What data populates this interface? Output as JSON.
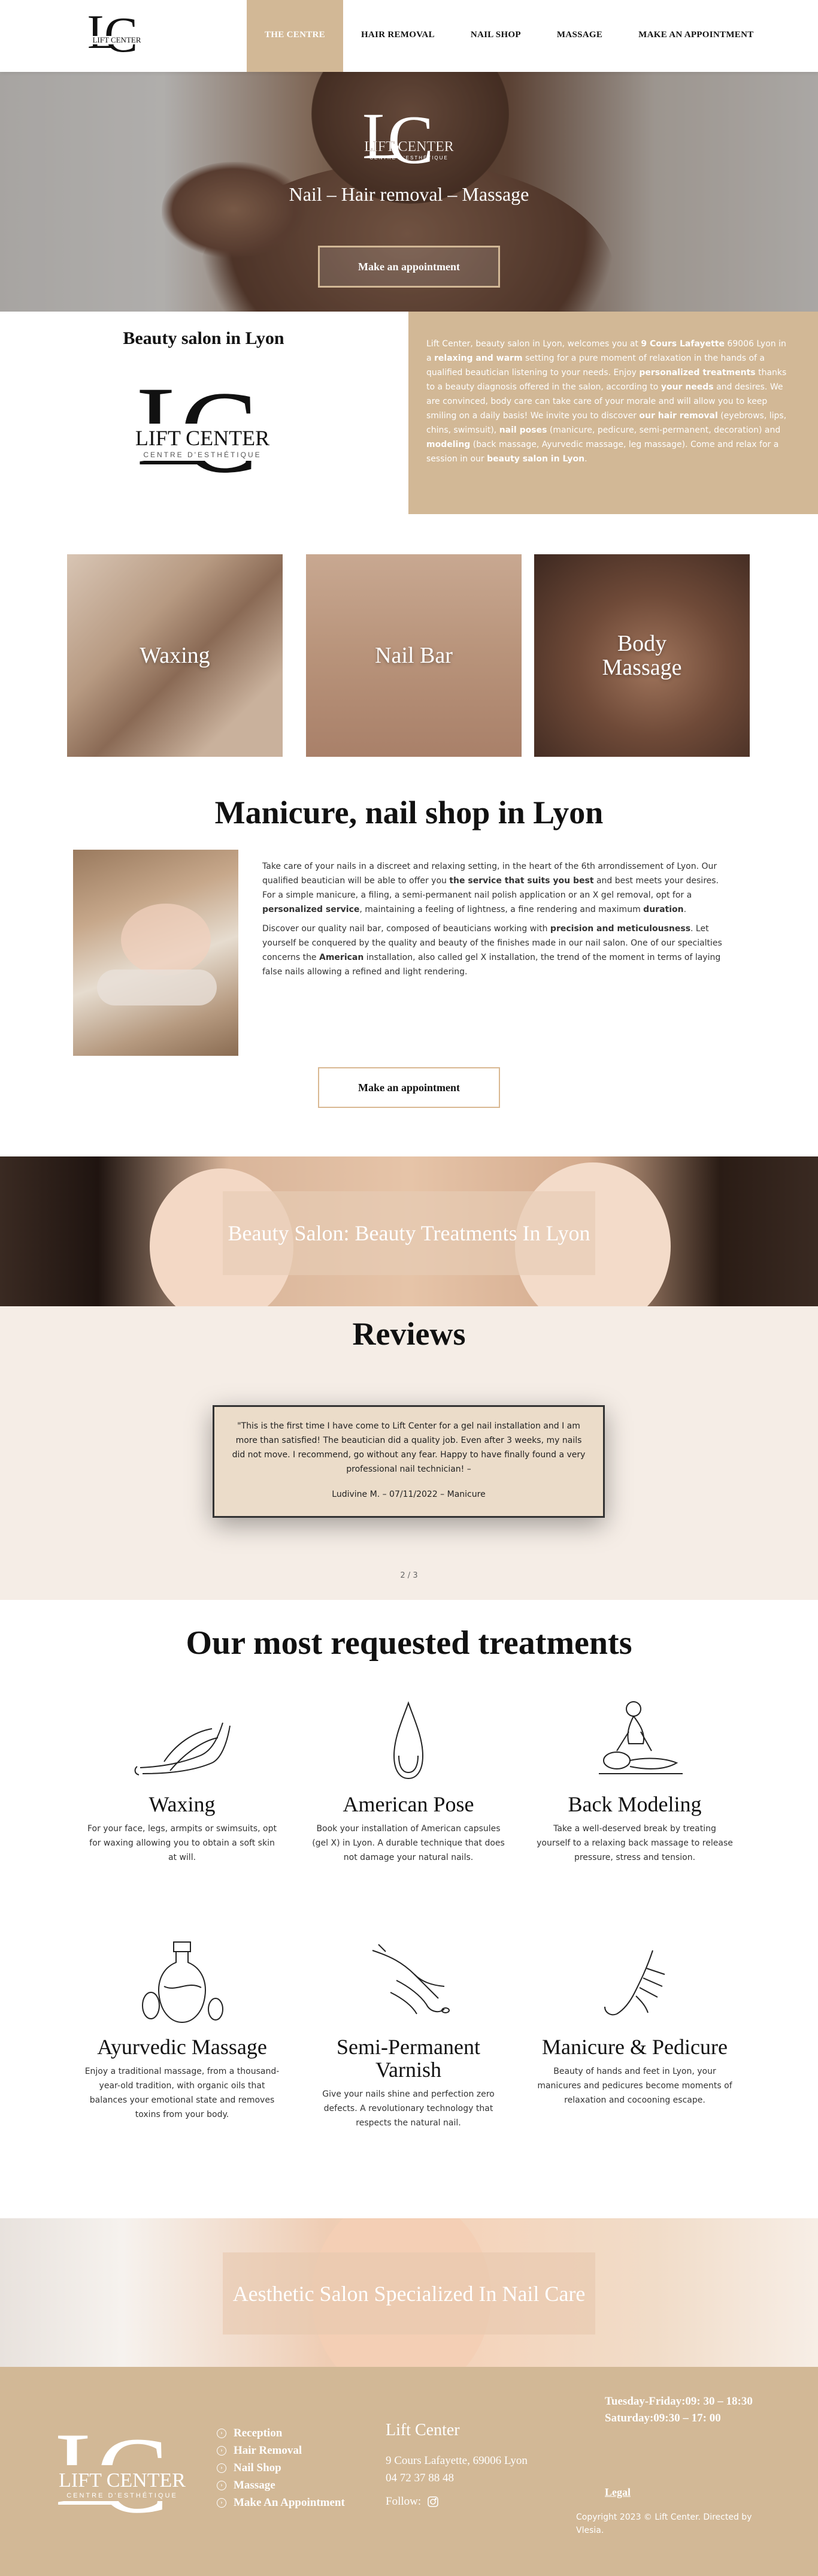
{
  "brand": {
    "name": "LIFT CENTER",
    "tagline": "CENTRE D'ESTHÉTIQUE",
    "monogram": "LC"
  },
  "nav": {
    "items": [
      {
        "label": "THE CENTRE",
        "active": true
      },
      {
        "label": "HAIR REMOVAL",
        "active": false
      },
      {
        "label": "NAIL SHOP",
        "active": false
      },
      {
        "label": "MASSAGE",
        "active": false
      },
      {
        "label": "MAKE AN APPOINTMENT",
        "active": false
      }
    ]
  },
  "hero": {
    "title": "Nail – Hair removal – Massage",
    "button": "Make an appointment"
  },
  "intro": {
    "title": "Beauty salon in Lyon",
    "p1": "Lift Center, beauty salon in Lyon, welcomes you at ",
    "p1_b": "9 Cours Lafayette",
    "p2": " 69006 Lyon in a ",
    "p2_b": "relaxing and warm",
    "p3": " setting for a pure moment of relaxation in the hands of a qualified beautician listening to your needs. Enjoy ",
    "p3_b": "personalized treatments",
    "p4": " thanks to a beauty diagnosis offered in the salon, according to ",
    "p4_b": "your needs",
    "p5": " and desires. We are convinced, body care can take care of your morale and will allow you to keep smiling on a daily basis! We invite you to discover ",
    "p5_b": "our hair removal",
    "p6": " (eyebrows, lips, chins, swimsuit), ",
    "p6_b": "nail poses",
    "p7": " (manicure, pedicure, semi-permanent, decoration) and ",
    "p7_b": "modeling",
    "p8": " (back massage, Ayurvedic massage, leg massage). Come and relax for a session in our ",
    "p8_b": "beauty salon in Lyon",
    "p9": "."
  },
  "services": [
    {
      "label": "Waxing"
    },
    {
      "label": "Nail Bar"
    },
    {
      "label": "Body Massage"
    }
  ],
  "manicure": {
    "title": "Manicure, nail shop in Lyon",
    "a1": "Take care of your nails in a discreet and relaxing setting, in the heart of the 6th arrondissement of Lyon. Our qualified beautician will be able to offer you ",
    "a1_b": "the service that suits you best",
    "a2": " and best meets your desires. For a simple manicure, a filing, a semi-permanent nail polish application or an X gel removal, opt for a ",
    "a2_b": "personalized service",
    "a3": ", maintaining a feeling of lightness, a fine rendering and maximum ",
    "a3_b": "duration",
    "a4": ".",
    "b1": "Discover our quality nail bar, composed of beauticians working with ",
    "b1_b": "precision and meticulousness",
    "b2": ". Let yourself be conquered by the quality and beauty of the finishes made in our nail salon. One of our specialties concerns the ",
    "b2_b": "American",
    "b3": " installation, also called gel X installation, the trend of the moment in terms of laying false nails allowing a refined and light rendering.",
    "button": "Make an appointment"
  },
  "banner1": {
    "title": "Beauty Salon: Beauty Treatments In Lyon"
  },
  "reviews": {
    "title": "Reviews",
    "quote": "\"This is the first time I have come to Lift Center for a gel nail installation and I am more than satisfied! The beautician did a quality job. Even after 3 weeks, my nails did not move. I recommend, go without any fear. Happy to have finally found a very professional nail technician! –",
    "author": "Ludivine M. – 07/11/2022 – Manicure",
    "pager": "2 / 3"
  },
  "treatments": {
    "title": "Our most requested treatments",
    "items": [
      {
        "title": "Waxing",
        "text": "For your face, legs, armpits or swimsuits, opt for waxing allowing you to obtain a soft skin at will.",
        "icon": "legs-icon"
      },
      {
        "title": "American Pose",
        "text": "Book your installation of American capsules (gel X) in Lyon. A durable technique that does not damage your natural nails.",
        "icon": "nail-icon"
      },
      {
        "title": "Back Modeling",
        "text": "Take a well-deserved break by treating yourself to a relaxing back massage to release pressure, stress and tension.",
        "icon": "massage-icon"
      },
      {
        "title": "Ayurvedic Massage",
        "text": "Enjoy a traditional massage, from a thousand-year-old tradition, with organic oils that balances your emotional state and removes toxins from your body.",
        "icon": "oil-bottle-icon"
      },
      {
        "title": "Semi-Permanent Varnish",
        "text": "Give your nails shine and perfection zero defects. A revolutionary technology that respects the natural nail.",
        "icon": "varnish-hand-icon"
      },
      {
        "title": "Manicure & Pedicure",
        "text": "Beauty of hands and feet in Lyon, your manicures and pedicures become moments of relaxation and cocooning escape.",
        "icon": "hand-icon"
      }
    ]
  },
  "banner2": {
    "title": "Aesthetic Salon Specialized In Nail Care"
  },
  "footer": {
    "nav": [
      "Reception",
      "Hair Removal",
      "Nail Shop",
      "Massage",
      "Make An Appointment"
    ],
    "name": "Lift Center",
    "address": "9 Cours Lafayette, 69006 Lyon",
    "phone": "04 72 37 88 48",
    "follow": "Follow:",
    "hours": "Tuesday-Friday:09: 30 – 18:30 Saturday:09:30 – 17: 00",
    "legal": "Legal",
    "copyright": "Copyright 2023 © Lift Center. Directed by Vlesia."
  },
  "colors": {
    "accent": "#d2b896",
    "text": "#111111",
    "review_bg": "#f5ede6"
  }
}
